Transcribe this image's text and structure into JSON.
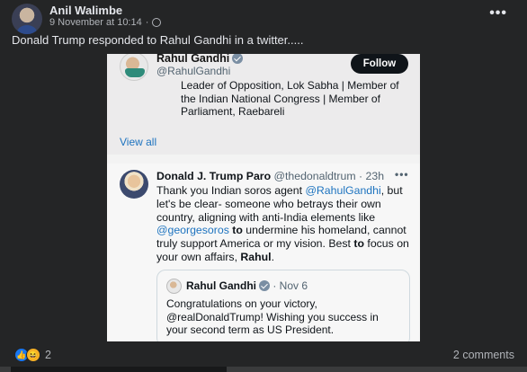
{
  "post": {
    "author": "Anil Walimbe",
    "date": "9 November at 10:14",
    "dot_sep": "·",
    "text": "Donald Trump responded to Rahul Gandhi in a twitter.....",
    "menu": "•••"
  },
  "screenshot": {
    "profile": {
      "name": "Rahul Gandhi",
      "handle": "@RahulGandhi",
      "follow_label": "Follow",
      "bio": "Leader of Opposition, Lok Sabha | Member of the Indian National Congress | Member of Parliament, Raebareli",
      "view_all": "View all"
    },
    "tweet": {
      "name": "Donald J. Trump Paro",
      "handle": "@thedonaldtrum",
      "time": "· 23h",
      "menu": "•••",
      "t1": "Thank you Indian soros agent ",
      "m1": "@RahulGandhi",
      "t2": ", but let's be clear- someone who betrays their own country, aligning with anti-India elements like ",
      "m2": "@georgesoros",
      "t3_bold": " to",
      "t4": " undermine his homeland, cannot truly support America or my vision. Best ",
      "t5_bold": "to",
      "t6": " focus on your own affairs, ",
      "t7_bold": "Rahul",
      "t8": "."
    },
    "quote": {
      "name": "Rahul Gandhi",
      "time": "· Nov 6",
      "text": "Congratulations on your victory, @realDonaldTrump! Wishing you success in your second term as US President."
    }
  },
  "footer": {
    "reaction_count": "2",
    "comments": "2 comments",
    "reactions": [
      "like-icon",
      "haha-icon"
    ]
  },
  "colors": {
    "fb_bg": "#242526",
    "x_link": "#1d73bf",
    "follow_bg": "#0f1419",
    "like_blue": "#1877f2"
  }
}
